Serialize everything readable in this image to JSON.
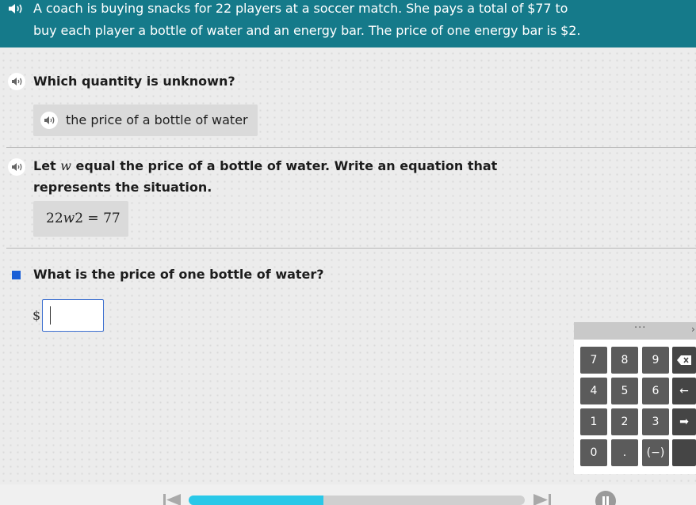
{
  "problem": {
    "line1": "A coach is buying snacks for 22 players at a soccer match. She pays a total of $77 to",
    "line2": "buy each player a bottle of water and an energy bar. The price of one energy bar is $2."
  },
  "q1": {
    "prompt": "Which quantity is unknown?",
    "answer": "the price of a bottle of water"
  },
  "q2": {
    "prompt_pre": "Let ",
    "prompt_var": "w",
    "prompt_post": " equal the price of a bottle of water. Write an equation that",
    "prompt_line2": "represents the situation.",
    "equation": {
      "coef": "22",
      "var": "w",
      "term": "2",
      "eq": " = ",
      "rhs": "77"
    }
  },
  "q3": {
    "prompt": "What is the price of one bottle of water?",
    "currency": "$",
    "input_value": ""
  },
  "keypad": {
    "header_dots": "···",
    "header_chevron": "›",
    "keys": [
      "7",
      "8",
      "9",
      "4",
      "5",
      "6",
      "1",
      "2",
      "3",
      "0",
      ".",
      "(−)"
    ],
    "backspace_icon": "⌫",
    "left_arrow_icon": "←",
    "right_arrow_icon": "➡"
  },
  "footer": {
    "progress_fraction": 0.4
  },
  "colors": {
    "banner": "#157a8a",
    "progress": "#29c8e8",
    "current_marker": "#1a5fd6",
    "input_border": "#3c6fd0"
  },
  "icons": {
    "audio": "speaker-icon",
    "skip_back": "skip-to-start-icon",
    "skip_forward": "skip-to-end-icon",
    "pause": "pause-icon"
  }
}
